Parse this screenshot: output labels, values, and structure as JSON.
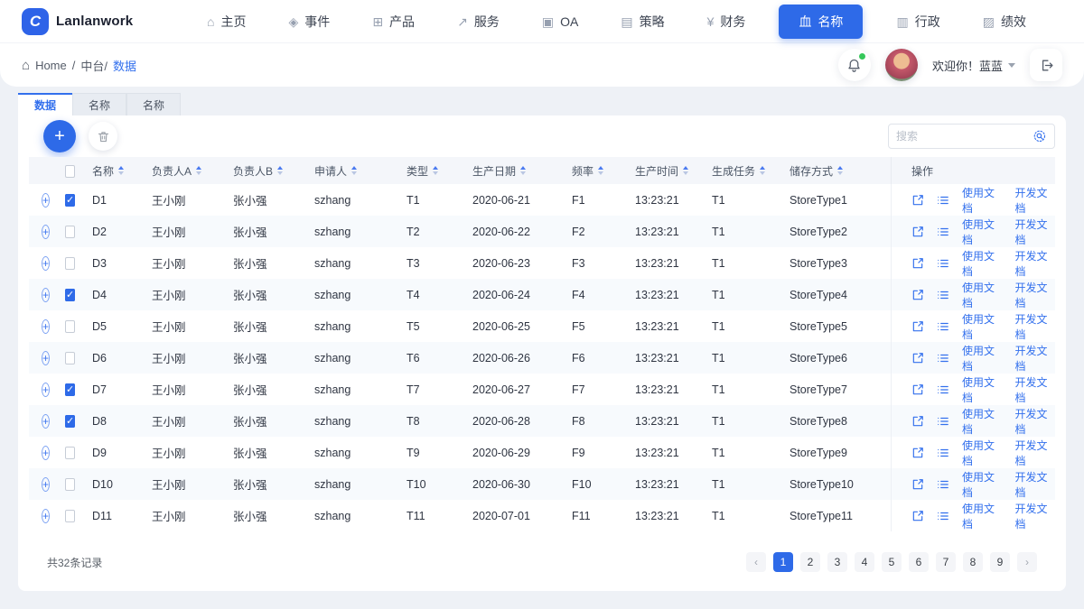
{
  "brand": "Lanlanwork",
  "nav": [
    {
      "label": "主页",
      "icon": "home-icon",
      "active": false
    },
    {
      "label": "事件",
      "icon": "layers-icon",
      "active": false
    },
    {
      "label": "产品",
      "icon": "product-box-icon",
      "active": false
    },
    {
      "label": "服务",
      "icon": "service-chart-icon",
      "active": false
    },
    {
      "label": "OA",
      "icon": "oa-icon",
      "active": false
    },
    {
      "label": "策略",
      "icon": "strategy-card-icon",
      "active": false
    },
    {
      "label": "财务",
      "icon": "finance-yen-icon",
      "active": false
    },
    {
      "label": "名称",
      "icon": "bank-icon",
      "active": true
    },
    {
      "label": "行政",
      "icon": "admin-doc-icon",
      "active": false
    },
    {
      "label": "绩效",
      "icon": "performance-chart-icon",
      "active": false
    }
  ],
  "header": {
    "breadcrumb": {
      "root": "Home",
      "sep1": "/",
      "section": "中台/",
      "current": "数据"
    },
    "welcome": "欢迎你！蓝蓝"
  },
  "tabs": [
    {
      "label": "数据",
      "active": true
    },
    {
      "label": "名称",
      "active": false
    },
    {
      "label": "名称",
      "active": false
    }
  ],
  "toolbar": {
    "search_placeholder": "搜索"
  },
  "table": {
    "columns": [
      {
        "label": "名称"
      },
      {
        "label": "负责人A"
      },
      {
        "label": "负责人B"
      },
      {
        "label": "申请人"
      },
      {
        "label": "类型"
      },
      {
        "label": "生产日期"
      },
      {
        "label": "频率"
      },
      {
        "label": "生产时间"
      },
      {
        "label": "生成任务"
      },
      {
        "label": "储存方式"
      }
    ],
    "ops_header": "操作",
    "ops_links": [
      "使用文档",
      "开发文档"
    ],
    "rows": [
      {
        "checked": true,
        "name": "D1",
        "owner_a": "王小刚",
        "owner_b": "张小强",
        "applicant": "szhang",
        "type": "T1",
        "date": "2020-06-21",
        "freq": "F1",
        "time": "13:23:21",
        "task": "T1",
        "store": "StoreType1"
      },
      {
        "checked": false,
        "name": "D2",
        "owner_a": "王小刚",
        "owner_b": "张小强",
        "applicant": "szhang",
        "type": "T2",
        "date": "2020-06-22",
        "freq": "F2",
        "time": "13:23:21",
        "task": "T1",
        "store": "StoreType2"
      },
      {
        "checked": false,
        "name": "D3",
        "owner_a": "王小刚",
        "owner_b": "张小强",
        "applicant": "szhang",
        "type": "T3",
        "date": "2020-06-23",
        "freq": "F3",
        "time": "13:23:21",
        "task": "T1",
        "store": "StoreType3"
      },
      {
        "checked": true,
        "name": "D4",
        "owner_a": "王小刚",
        "owner_b": "张小强",
        "applicant": "szhang",
        "type": "T4",
        "date": "2020-06-24",
        "freq": "F4",
        "time": "13:23:21",
        "task": "T1",
        "store": "StoreType4"
      },
      {
        "checked": false,
        "name": "D5",
        "owner_a": "王小刚",
        "owner_b": "张小强",
        "applicant": "szhang",
        "type": "T5",
        "date": "2020-06-25",
        "freq": "F5",
        "time": "13:23:21",
        "task": "T1",
        "store": "StoreType5"
      },
      {
        "checked": false,
        "name": "D6",
        "owner_a": "王小刚",
        "owner_b": "张小强",
        "applicant": "szhang",
        "type": "T6",
        "date": "2020-06-26",
        "freq": "F6",
        "time": "13:23:21",
        "task": "T1",
        "store": "StoreType6"
      },
      {
        "checked": true,
        "name": "D7",
        "owner_a": "王小刚",
        "owner_b": "张小强",
        "applicant": "szhang",
        "type": "T7",
        "date": "2020-06-27",
        "freq": "F7",
        "time": "13:23:21",
        "task": "T1",
        "store": "StoreType7"
      },
      {
        "checked": true,
        "name": "D8",
        "owner_a": "王小刚",
        "owner_b": "张小强",
        "applicant": "szhang",
        "type": "T8",
        "date": "2020-06-28",
        "freq": "F8",
        "time": "13:23:21",
        "task": "T1",
        "store": "StoreType8"
      },
      {
        "checked": false,
        "name": "D9",
        "owner_a": "王小刚",
        "owner_b": "张小强",
        "applicant": "szhang",
        "type": "T9",
        "date": "2020-06-29",
        "freq": "F9",
        "time": "13:23:21",
        "task": "T1",
        "store": "StoreType9"
      },
      {
        "checked": false,
        "name": "D10",
        "owner_a": "王小刚",
        "owner_b": "张小强",
        "applicant": "szhang",
        "type": "T10",
        "date": "2020-06-30",
        "freq": "F10",
        "time": "13:23:21",
        "task": "T1",
        "store": "StoreType10"
      },
      {
        "checked": false,
        "name": "D11",
        "owner_a": "王小刚",
        "owner_b": "张小强",
        "applicant": "szhang",
        "type": "T11",
        "date": "2020-07-01",
        "freq": "F11",
        "time": "13:23:21",
        "task": "T1",
        "store": "StoreType11"
      }
    ]
  },
  "pagination": {
    "total_text": "共32条记录",
    "prev": "‹",
    "next": "›",
    "pages": [
      {
        "n": "1",
        "active": true
      },
      {
        "n": "2",
        "active": false
      },
      {
        "n": "3",
        "active": false
      },
      {
        "n": "4",
        "active": false
      },
      {
        "n": "5",
        "active": false
      },
      {
        "n": "6",
        "active": false
      },
      {
        "n": "7",
        "active": false
      },
      {
        "n": "8",
        "active": false
      },
      {
        "n": "9",
        "active": false
      }
    ]
  },
  "colors": {
    "primary": "#2e6ae8",
    "link": "#3370ed",
    "active_page_bg": "#2e6ae8",
    "notification_dot": "#35c75a"
  }
}
